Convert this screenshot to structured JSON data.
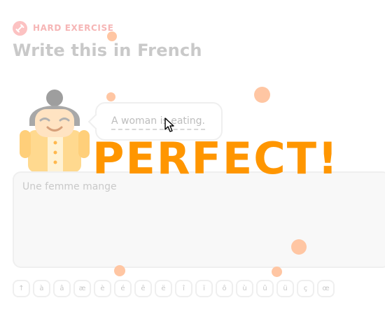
{
  "header": {
    "badge_label": "HARD EXERCISE",
    "badge_color": "#fcc2c2",
    "title": "Write this in French"
  },
  "prompt": {
    "sentence": "A woman is eating."
  },
  "answer": {
    "value": "Une femme mange"
  },
  "keyboard": {
    "keys": [
      "↑",
      "à",
      "â",
      "æ",
      "è",
      "é",
      "ê",
      "ë",
      "î",
      "ï",
      "ô",
      "ù",
      "û",
      "ü",
      "ç",
      "œ"
    ]
  },
  "feedback": {
    "text": "PERFECT!",
    "color": "#ff9600"
  },
  "icons": {
    "badge": "dumbbell-icon",
    "character": "grandma-character",
    "cursor": "mouse-pointer-icon"
  }
}
